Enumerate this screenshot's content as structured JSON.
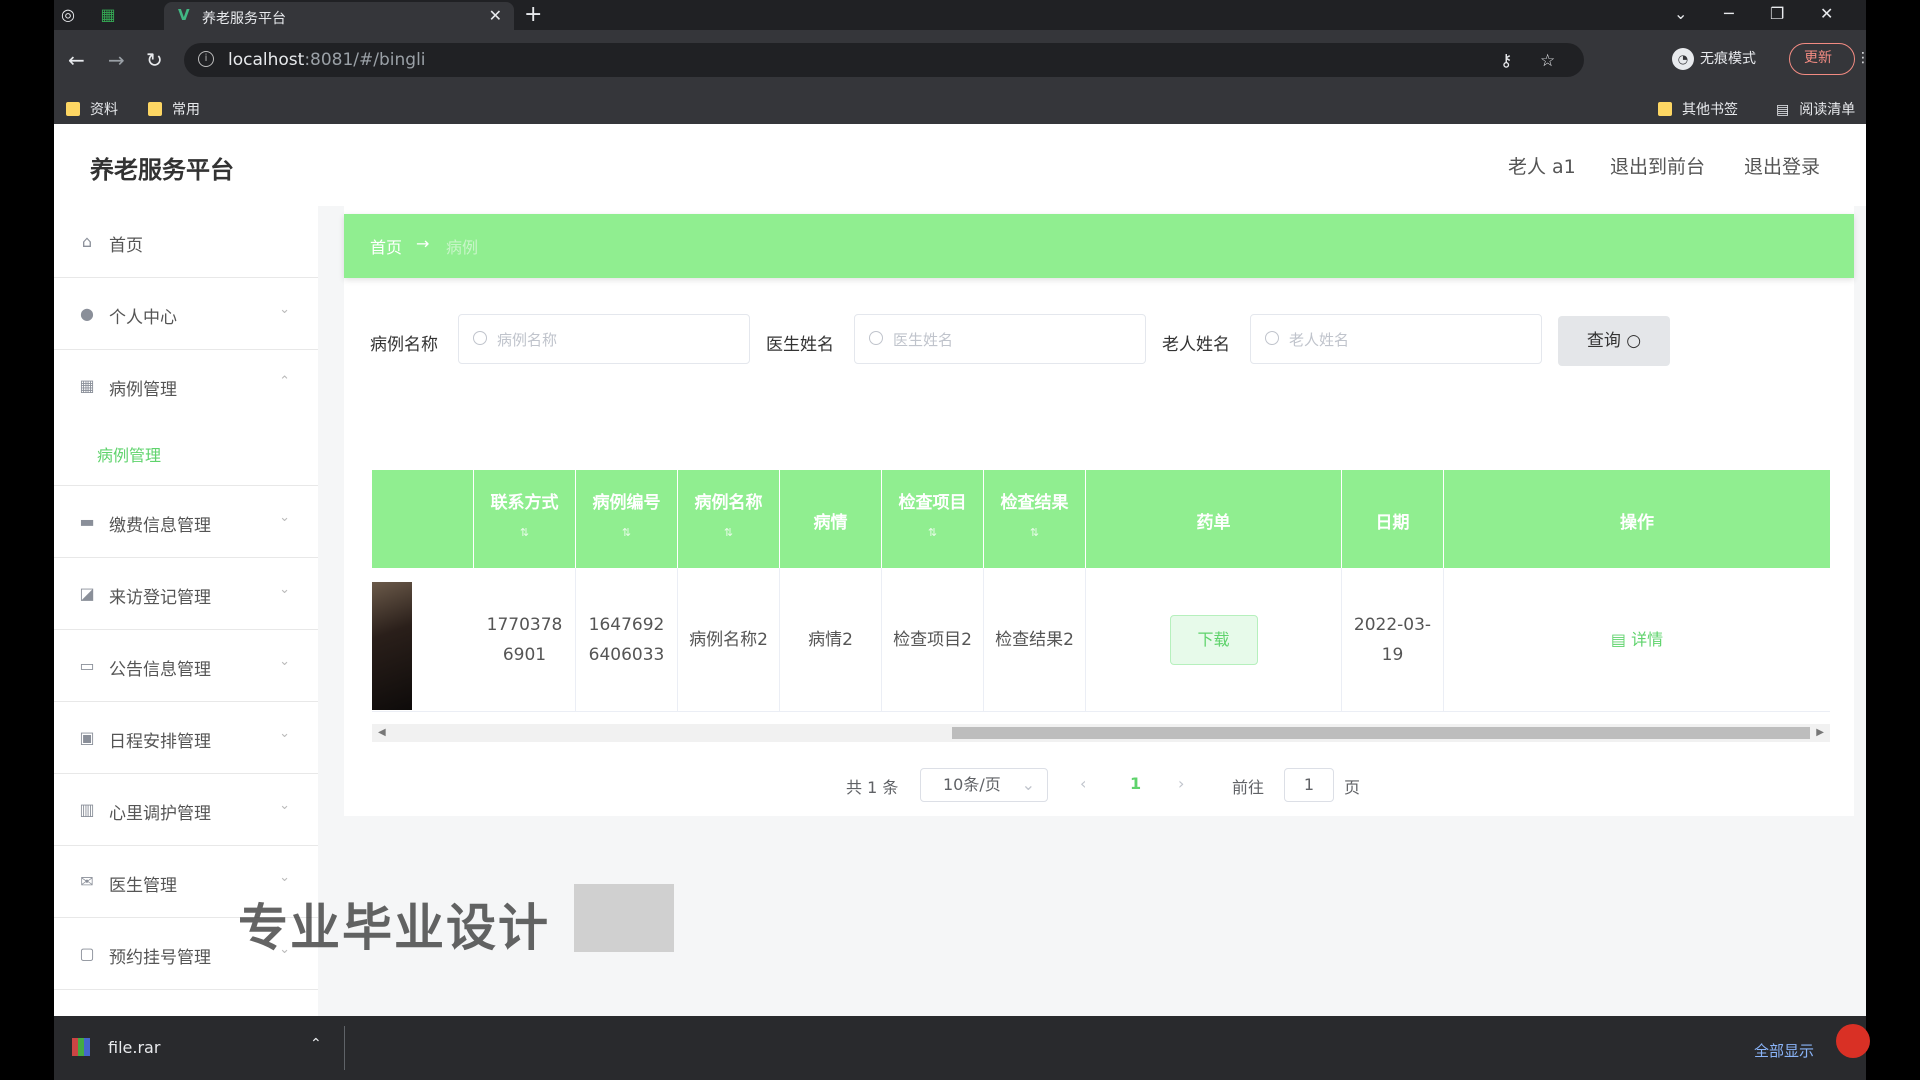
{
  "browser": {
    "tab_title": "养老服务平台",
    "url_host": "localhost",
    "url_rest": ":8081/#/bingli",
    "incognito_label": "无痕模式",
    "update_label": "更新",
    "bookmarks": [
      "资料",
      "常用"
    ],
    "other_bookmarks": "其他书签",
    "reading_list": "阅读清单"
  },
  "app": {
    "brand": "养老服务平台",
    "user": "老人 a1",
    "to_front": "退出到前台",
    "logout": "退出登录"
  },
  "sidebar": {
    "items": [
      {
        "label": "首页",
        "icon": "home-icon"
      },
      {
        "label": "个人中心",
        "icon": "user-icon"
      },
      {
        "label": "病例管理",
        "icon": "grid-icon"
      },
      {
        "label": "缴费信息管理",
        "icon": "card-icon"
      },
      {
        "label": "来访登记管理",
        "icon": "chart-icon"
      },
      {
        "label": "公告信息管理",
        "icon": "briefcase-icon"
      },
      {
        "label": "日程安排管理",
        "icon": "suitcase-icon"
      },
      {
        "label": "心里调护管理",
        "icon": "clipboard-icon"
      },
      {
        "label": "医生管理",
        "icon": "mail-icon"
      },
      {
        "label": "预约挂号管理",
        "icon": "message-icon"
      }
    ],
    "submenu_label": "病例管理"
  },
  "breadcrumb": {
    "home": "首页",
    "arrow": "→",
    "current": "病例"
  },
  "search": {
    "fields": [
      {
        "label": "病例名称",
        "placeholder": "病例名称"
      },
      {
        "label": "医生姓名",
        "placeholder": "医生姓名"
      },
      {
        "label": "老人姓名",
        "placeholder": "老人姓名"
      }
    ],
    "button": "查询"
  },
  "table": {
    "headers": [
      "联系方式",
      "病例编号",
      "病例名称",
      "病情",
      "检查项目",
      "检查结果",
      "药单",
      "日期",
      "操作"
    ],
    "row": {
      "contact": "17703786901",
      "case_no": "16476926406033",
      "case_name": "病例名称2",
      "condition": "病情2",
      "exam_item": "检查项目2",
      "exam_result": "检查结果2",
      "prescription_button": "下载",
      "date": "2022-03-19",
      "detail": "详情"
    }
  },
  "pagination": {
    "total": "共 1 条",
    "page_size": "10条/页",
    "current_page": "1",
    "goto_prefix": "前往",
    "goto_value": "1",
    "goto_suffix": "页"
  },
  "overlay": {
    "watermark": "专业毕业设计"
  },
  "download_bar": {
    "file": "file.rar",
    "show_all": "全部显示"
  },
  "colors": {
    "accent_green": "#90ee90",
    "link_green": "#5fd36c"
  }
}
